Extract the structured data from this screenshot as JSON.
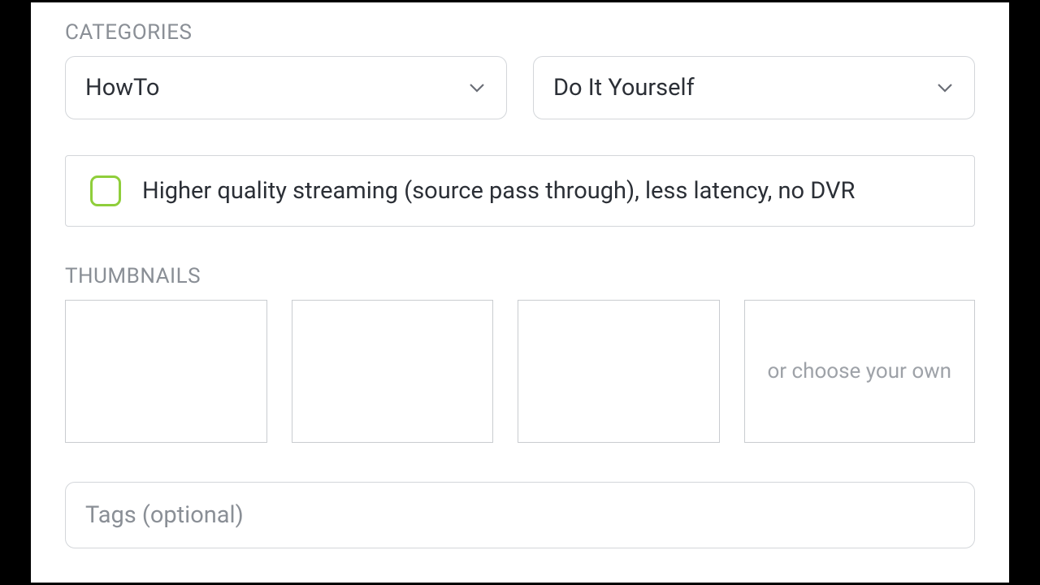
{
  "categories": {
    "label": "CATEGORIES",
    "select1": "HowTo",
    "select2": "Do It Yourself"
  },
  "streaming_option": {
    "label": "Higher quality streaming (source pass through), less latency, no DVR"
  },
  "thumbnails": {
    "label": "THUMBNAILS",
    "choose_text": "or choose your own"
  },
  "tags": {
    "placeholder": "Tags (optional)"
  }
}
